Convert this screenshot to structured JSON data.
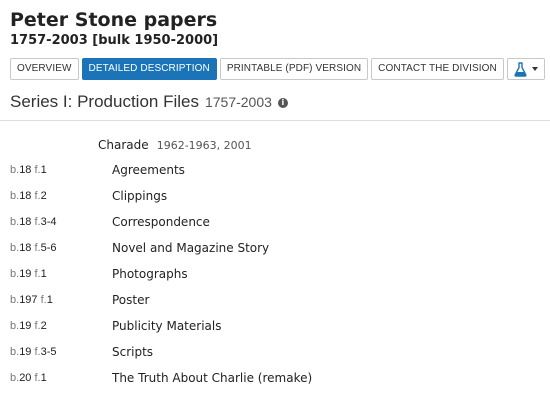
{
  "collection": {
    "title": "Peter Stone papers",
    "dates": "1757-2003 [bulk 1950-2000]"
  },
  "nav": {
    "overview": "OVERVIEW",
    "detailed": "DETAILED DESCRIPTION",
    "printable": "PRINTABLE (PDF) VERSION",
    "contact": "CONTACT THE DIVISION",
    "active": "DETAILED DESCRIPTION",
    "accent_color": "#1b74b7"
  },
  "series": {
    "title": "Series I: Production Files",
    "dates": "1757-2003",
    "info_icon": "info-icon"
  },
  "subseries": {
    "name": "Charade",
    "dates": "1962-1963, 2001"
  },
  "items": [
    {
      "box_label": "b.",
      "box": "18",
      "folder_label": "f.",
      "folder": "1",
      "title": "Agreements"
    },
    {
      "box_label": "b.",
      "box": "18",
      "folder_label": "f.",
      "folder": "2",
      "title": "Clippings"
    },
    {
      "box_label": "b.",
      "box": "18",
      "folder_label": "f.",
      "folder": "3-4",
      "title": "Correspondence"
    },
    {
      "box_label": "b.",
      "box": "18",
      "folder_label": "f.",
      "folder": "5-6",
      "title": "Novel and Magazine Story"
    },
    {
      "box_label": "b.",
      "box": "19",
      "folder_label": "f.",
      "folder": "1",
      "title": "Photographs"
    },
    {
      "box_label": "b.",
      "box": "197",
      "folder_label": "f.",
      "folder": "1",
      "title": "Poster"
    },
    {
      "box_label": "b.",
      "box": "19",
      "folder_label": "f.",
      "folder": "2",
      "title": "Publicity Materials"
    },
    {
      "box_label": "b.",
      "box": "19",
      "folder_label": "f.",
      "folder": "3-5",
      "title": "Scripts"
    },
    {
      "box_label": "b.",
      "box": "20",
      "folder_label": "f.",
      "folder": "1",
      "title": "The Truth About Charlie (remake)"
    }
  ]
}
